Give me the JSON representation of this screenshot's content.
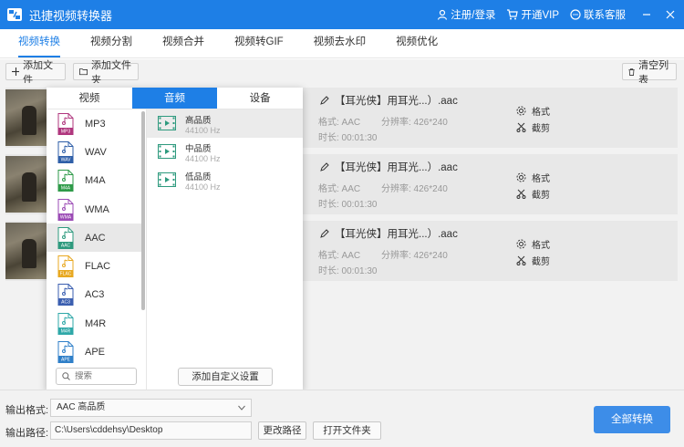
{
  "app": {
    "title": "迅捷视频转换器"
  },
  "titlebar": {
    "login": "注册/登录",
    "vip": "开通VIP",
    "support": "联系客服"
  },
  "tabs": [
    {
      "label": "视频转换",
      "active": true
    },
    {
      "label": "视频分割"
    },
    {
      "label": "视频合并"
    },
    {
      "label": "视频转GIF"
    },
    {
      "label": "视频去水印"
    },
    {
      "label": "视频优化"
    }
  ],
  "toolbar": {
    "add_file": "添加文件",
    "add_folder": "添加文件夹",
    "clear_list": "清空列表"
  },
  "files": [
    {
      "name": "【耳光侠】用耳光...）.aac",
      "format_label": "格式: AAC",
      "resolution_label": "分辨率: 426*240",
      "duration_label": "时长: 00:01:30",
      "format_action": "格式",
      "cut_action": "截剪"
    },
    {
      "name": "【耳光侠】用耳光...）.aac",
      "format_label": "格式: AAC",
      "resolution_label": "分辨率: 426*240",
      "duration_label": "时长: 00:01:30",
      "format_action": "格式",
      "cut_action": "截剪"
    },
    {
      "name": "【耳光侠】用耳光...）.aac",
      "format_label": "格式: AAC",
      "resolution_label": "分辨率: 426*240",
      "duration_label": "时长: 00:01:30",
      "format_action": "格式",
      "cut_action": "截剪"
    }
  ],
  "popup": {
    "tabs": [
      {
        "label": "视频"
      },
      {
        "label": "音频",
        "active": true
      },
      {
        "label": "设备"
      }
    ],
    "formats": [
      {
        "label": "MP3",
        "badge": "MP3",
        "color": "#b0377e"
      },
      {
        "label": "WAV",
        "badge": "WAV",
        "color": "#2f5fa8"
      },
      {
        "label": "M4A",
        "badge": "M4A",
        "color": "#2e9a48"
      },
      {
        "label": "WMA",
        "badge": "WMA",
        "color": "#9b4bb5"
      },
      {
        "label": "AAC",
        "badge": "AAC",
        "color": "#2e9a7e",
        "selected": true
      },
      {
        "label": "FLAC",
        "badge": "FLAC",
        "color": "#e8a820"
      },
      {
        "label": "AC3",
        "badge": "AC3",
        "color": "#3b5fb0"
      },
      {
        "label": "M4R",
        "badge": "M4R",
        "color": "#2fa8a8"
      },
      {
        "label": "APE",
        "badge": "APE",
        "color": "#2f7fc8"
      }
    ],
    "qualities": [
      {
        "name": "高品质",
        "hz": "44100 Hz",
        "selected": true
      },
      {
        "name": "中品质",
        "hz": "44100 Hz"
      },
      {
        "name": "低品质",
        "hz": "44100 Hz"
      }
    ],
    "search_placeholder": "搜索",
    "custom_button": "添加自定义设置"
  },
  "bottom": {
    "output_format_label": "输出格式:",
    "output_format_value": "AAC  高品质",
    "output_path_label": "输出路径:",
    "output_path_value": "C:\\Users\\cddehsy\\Desktop",
    "change_path": "更改路径",
    "open_folder": "打开文件夹",
    "convert_all": "全部转换"
  },
  "colors": {
    "accent": "#1e7fe6",
    "convert": "#3d8de8"
  }
}
